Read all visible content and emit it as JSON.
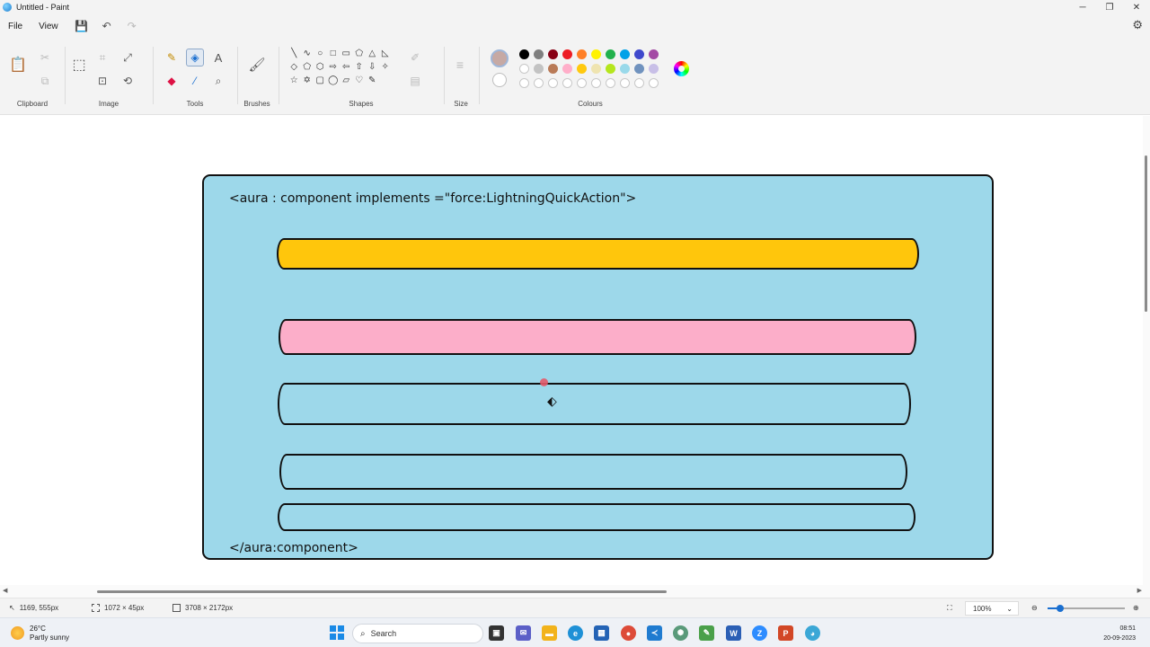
{
  "window": {
    "title": "Untitled - Paint",
    "minimize": "─",
    "restore": "❐",
    "close": "✕"
  },
  "menu": {
    "file": "File",
    "view": "View",
    "save_icon": "💾",
    "undo_icon": "↶",
    "redo_icon": "↷",
    "settings_icon": "⚙"
  },
  "ribbon": {
    "groups": {
      "clipboard": "Clipboard",
      "image": "Image",
      "tools": "Tools",
      "brushes": "Brushes",
      "shapes": "Shapes",
      "size": "Size",
      "colours": "Colours"
    },
    "shapes": [
      "╲",
      "∿",
      "○",
      "□",
      "▭",
      "⬠",
      "△",
      "◺",
      "◇",
      "⬠",
      "⬡",
      "⇨",
      "⇦",
      "⇧",
      "⇩",
      "✧",
      "☆",
      "✡",
      "▢",
      "◯",
      "▱",
      "♡",
      "✎"
    ],
    "colors": {
      "row1": [
        "#000000",
        "#7f7f7f",
        "#880015",
        "#ed1c24",
        "#ff7f27",
        "#fff200",
        "#22b14c",
        "#00a2e8",
        "#3f48cc",
        "#a349a4"
      ],
      "row2": [
        "#ffffff",
        "#c3c3c3",
        "#b97a57",
        "#ffaec9",
        "#ffc90e",
        "#efe4b0",
        "#b5e61d",
        "#99d9ea",
        "#7092be",
        "#c8bfe7"
      ]
    },
    "primary_color": "#c6a9a4",
    "secondary_color": "#ffffff"
  },
  "canvas": {
    "background": "#9dd8ea",
    "open_tag": "<aura : component implements =\"force:LightningQuickAction\">",
    "close_tag": "</aura:component>",
    "bars": [
      {
        "name": "yellow-bar",
        "color": "#ffc60c"
      },
      {
        "name": "pink-bar",
        "color": "#fcaec9"
      },
      {
        "name": "empty-bar-1",
        "color": "#9dd8ea"
      },
      {
        "name": "empty-bar-2",
        "color": "#9dd8ea"
      },
      {
        "name": "empty-bar-3",
        "color": "#9dd8ea"
      }
    ]
  },
  "status": {
    "cursor_pos": "1169, 555px",
    "selection_size": "1072 × 45px",
    "canvas_size": "3708 × 2172px",
    "zoom": "100%"
  },
  "taskbar": {
    "temperature": "26°C",
    "weather": "Partly sunny",
    "search_placeholder": "Search",
    "time": "08:51",
    "date": "20-09-2023"
  }
}
